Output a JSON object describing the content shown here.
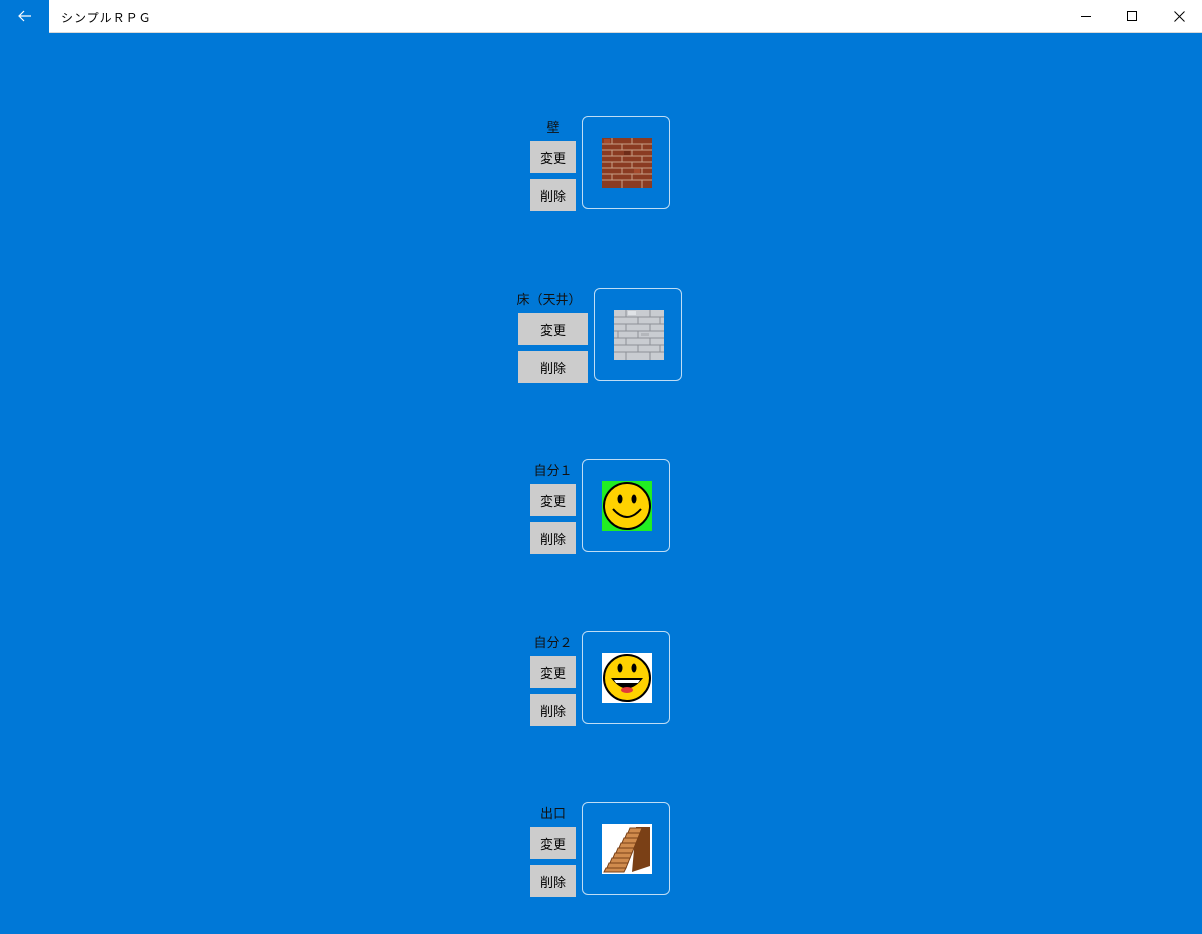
{
  "window": {
    "title": "シンプルＲＰＧ",
    "back_icon": "arrow-left-icon",
    "minimize_icon": "minimize-icon",
    "maximize_icon": "maximize-icon",
    "close_icon": "close-icon",
    "background_color": "#0078d7"
  },
  "tiles": [
    {
      "label": "壁",
      "change_label": "変更",
      "delete_label": "削除",
      "image_icon": "brick-wall-icon"
    },
    {
      "label": "床（天井）",
      "change_label": "変更",
      "delete_label": "削除",
      "image_icon": "stone-floor-icon"
    },
    {
      "label": "自分１",
      "change_label": "変更",
      "delete_label": "削除",
      "image_icon": "smiley-face-icon"
    },
    {
      "label": "自分２",
      "change_label": "変更",
      "delete_label": "削除",
      "image_icon": "laughing-face-icon"
    },
    {
      "label": "出口",
      "change_label": "変更",
      "delete_label": "削除",
      "image_icon": "stairs-icon"
    }
  ]
}
